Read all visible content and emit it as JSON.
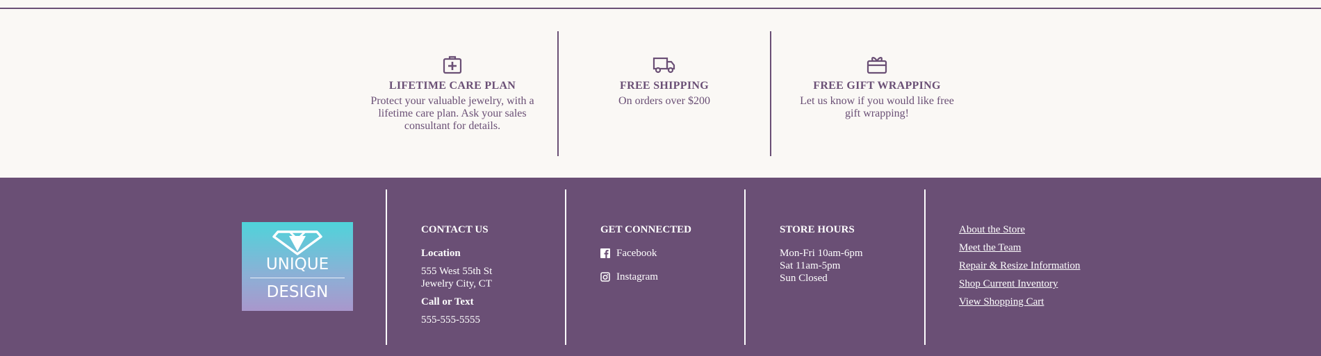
{
  "features": [
    {
      "icon": "care-kit-icon",
      "title": "LIFETIME CARE PLAN",
      "desc": "Protect your valuable jewelry, with a lifetime care plan. Ask your sales consultant for details."
    },
    {
      "icon": "truck-icon",
      "title": "FREE SHIPPING",
      "desc": "On orders over $200"
    },
    {
      "icon": "gift-icon",
      "title": "FREE GIFT WRAPPING",
      "desc": "Let us know if you would like free gift wrapping!"
    }
  ],
  "logo": {
    "line1": "UNIQUE",
    "line2": "DESIGN"
  },
  "contact": {
    "heading": "CONTACT US",
    "location_label": "Location",
    "address1": "555 West 55th St",
    "address2": "Jewelry City, CT",
    "call_label": "Call or Text",
    "phone": "555-555-5555"
  },
  "connected": {
    "heading": "GET CONNECTED",
    "facebook": "Facebook",
    "instagram": "Instagram"
  },
  "hours": {
    "heading": "STORE HOURS",
    "line1": "Mon-Fri 10am-6pm",
    "line2": "Sat 11am-5pm",
    "line3": "Sun Closed"
  },
  "links": [
    "About the Store",
    "Meet the Team",
    "Repair & Resize Information",
    "Shop Current Inventory",
    "View Shopping Cart"
  ],
  "colors": {
    "brand": "#6a4f75",
    "background": "#faf8f5"
  }
}
